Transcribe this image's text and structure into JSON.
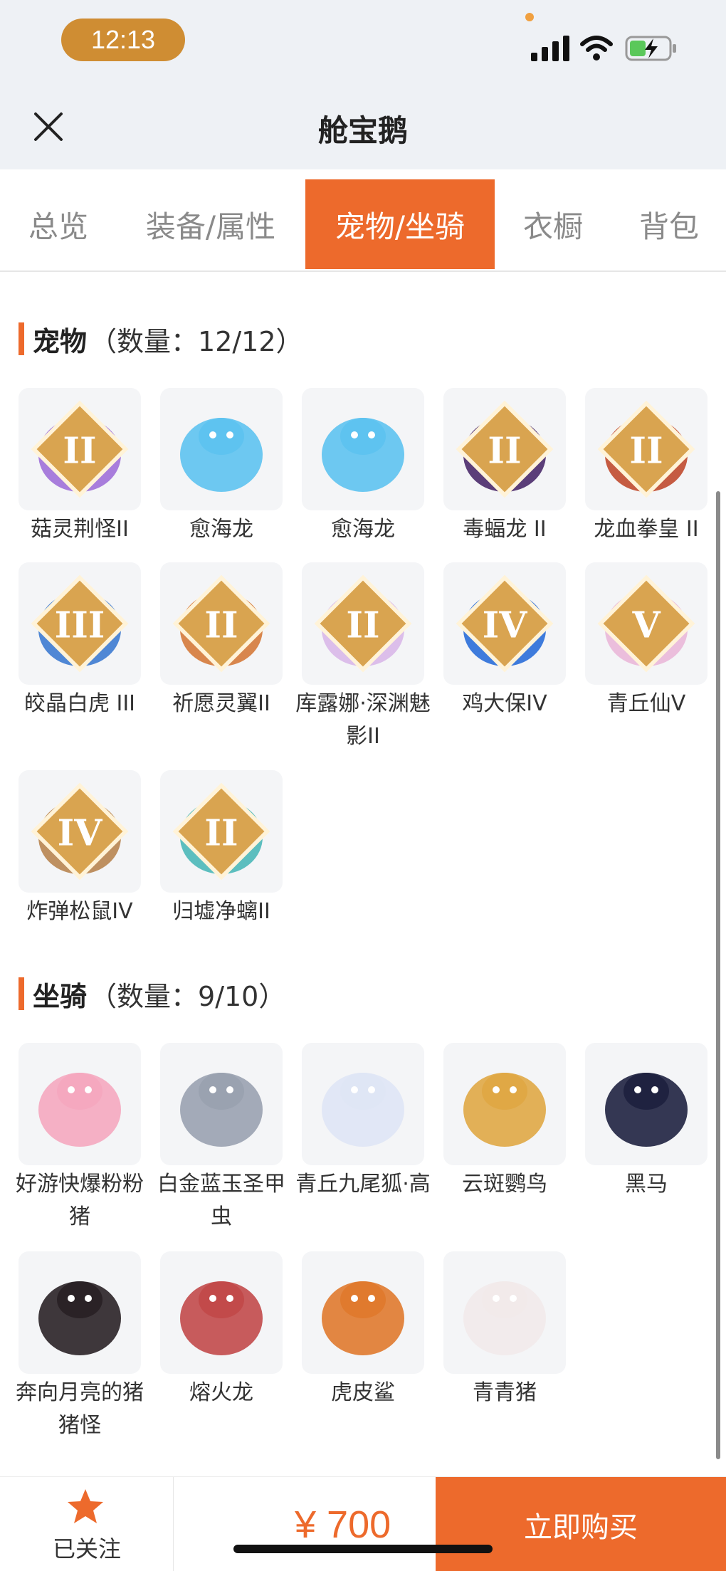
{
  "status_bar": {
    "time": "12:13"
  },
  "header": {
    "title": "舱宝鹅"
  },
  "tabs": [
    "总览",
    "装备/属性",
    "宠物/坐骑",
    "衣橱",
    "背包"
  ],
  "pets": {
    "title": "宠物",
    "count": "（数量：12/12）",
    "items": [
      {
        "name": "菇灵荆怪II",
        "badge": "II",
        "color": "#a070d8"
      },
      {
        "name": "愈海龙",
        "badge": "",
        "color": "#5ec3f0"
      },
      {
        "name": "愈海龙",
        "badge": "",
        "color": "#5ec3f0"
      },
      {
        "name": "毒蝠龙 II",
        "badge": "II",
        "color": "#4a2a6a"
      },
      {
        "name": "龙血拳皇 II",
        "badge": "II",
        "color": "#c04a2e"
      },
      {
        "name": "皎晶白虎 III",
        "badge": "III",
        "color": "#3d7bd0"
      },
      {
        "name": "祈愿灵翼II",
        "badge": "II",
        "color": "#d57a3a"
      },
      {
        "name": "库露娜·深渊魅影II",
        "badge": "II",
        "color": "#d9b8e8"
      },
      {
        "name": "鸡大保IV",
        "badge": "IV",
        "color": "#2a6ed8"
      },
      {
        "name": "青丘仙V",
        "badge": "V",
        "color": "#eab8d8"
      },
      {
        "name": "炸弹松鼠IV",
        "badge": "IV",
        "color": "#b88550"
      },
      {
        "name": "归墟净螭II",
        "badge": "II",
        "color": "#4bb8b8"
      }
    ]
  },
  "mounts": {
    "title": "坐骑",
    "count": "（数量：9/10）",
    "items": [
      {
        "name": "好游快爆粉粉猪",
        "color": "#f5a8bf"
      },
      {
        "name": "白金蓝玉圣甲虫",
        "color": "#9aa2b0"
      },
      {
        "name": "青丘九尾狐·高",
        "color": "#dfe6f5"
      },
      {
        "name": "云斑鹦鸟",
        "color": "#e0a845"
      },
      {
        "name": "黑马",
        "color": "#1f2240"
      },
      {
        "name": "奔向月亮的猪猪怪",
        "color": "#2a2226"
      },
      {
        "name": "熔火龙",
        "color": "#c24a4a"
      },
      {
        "name": "虎皮鲨",
        "color": "#e07a2e"
      },
      {
        "name": "青青猪",
        "color": "#f2eaea"
      }
    ]
  },
  "footer": {
    "follow_label": "已关注",
    "price": "¥ 700",
    "buy_label": "立即购买"
  }
}
